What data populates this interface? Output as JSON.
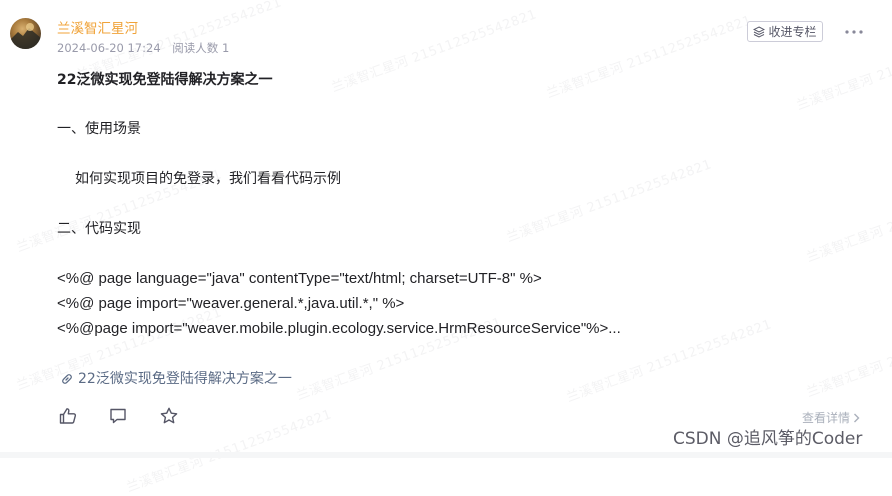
{
  "author": {
    "name": "兰溪智汇星河",
    "date": "2024-06-20 17:24",
    "reads": "阅读人数 1"
  },
  "header": {
    "collect_label": "收进专栏"
  },
  "article": {
    "title": "22泛微实现免登陆得解决方案之一",
    "section1": "一、使用场景",
    "para1": "如何实现项目的免登录，我们看看代码示例",
    "section2": "二、代码实现",
    "code_lines": [
      "<%@ page language=\"java\" contentType=\"text/html; charset=UTF-8\" %>",
      "<%@ page import=\"weaver.general.*,java.util.*,\" %>",
      "<%@page import=\"weaver.mobile.plugin.ecology.service.HrmResourceService\"%>..."
    ],
    "link_text": "22泛微实现免登陆得解决方案之一"
  },
  "actions": {
    "view_detail": "查看详情"
  },
  "watermark": {
    "text": "兰溪智汇星河 215112525542821",
    "footer": "CSDN @追风筝的Coder"
  },
  "colors": {
    "author": "#f0a339",
    "link": "#5b6b85",
    "meta": "#999aaa"
  }
}
